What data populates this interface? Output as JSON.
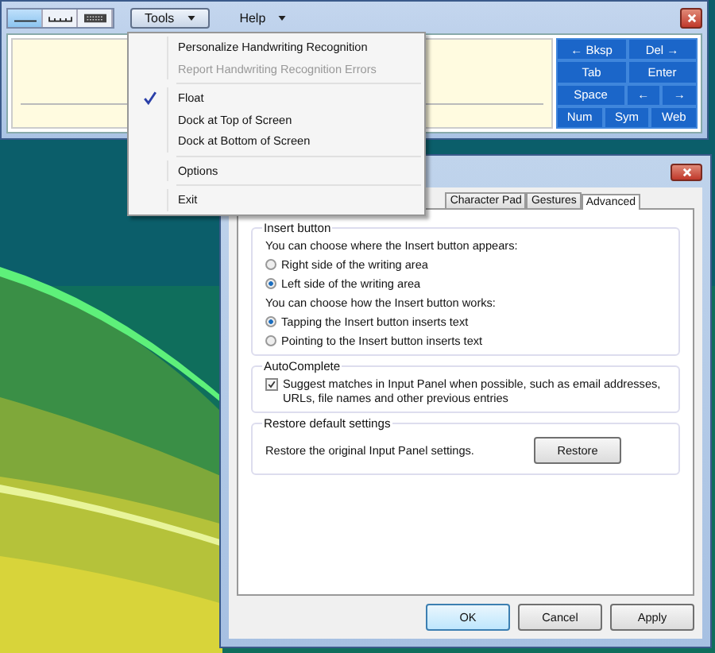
{
  "input_panel": {
    "mode_buttons": [
      {
        "selected": true
      },
      {
        "selected": false
      },
      {
        "selected": false
      }
    ],
    "menus": [
      {
        "label": "Tools",
        "open": true
      },
      {
        "label": "Help",
        "open": false
      }
    ],
    "keys": [
      [
        {
          "label": "← Bksp",
          "kind": "normal"
        },
        {
          "label": "Del →",
          "kind": "normal"
        }
      ],
      [
        {
          "label": "Tab",
          "kind": "normal"
        },
        {
          "label": "Enter",
          "kind": "normal"
        }
      ],
      [
        {
          "label": "Space",
          "kind": "wide"
        },
        {
          "label": "←",
          "kind": "normal"
        },
        {
          "label": "→",
          "kind": "normal"
        }
      ],
      [
        {
          "label": "Num",
          "kind": "normal"
        },
        {
          "label": "Sym",
          "kind": "normal"
        },
        {
          "label": "Web",
          "kind": "normal"
        }
      ]
    ]
  },
  "tools_menu": [
    [
      {
        "label": "Personalize Handwriting Recognition",
        "disabled": false,
        "checked": false
      },
      {
        "label": "Report Handwriting Recognition Errors",
        "disabled": true,
        "checked": false
      }
    ],
    [
      {
        "label": "Float",
        "disabled": false,
        "checked": true
      },
      {
        "label": "Dock at Top of Screen",
        "disabled": false,
        "checked": false
      },
      {
        "label": "Dock at Bottom of Screen",
        "disabled": false,
        "checked": false
      }
    ],
    [
      {
        "label": "Options",
        "disabled": false,
        "checked": false
      }
    ],
    [
      {
        "label": "Exit",
        "disabled": false,
        "checked": false
      }
    ]
  ],
  "dialog": {
    "tabs": [
      {
        "label": "Character Pad",
        "selected": false
      },
      {
        "label": "Gestures",
        "selected": false
      },
      {
        "label": "Advanced",
        "selected": true
      }
    ],
    "insert_button": {
      "title": "Insert button",
      "prompt_position": "You can choose where the Insert button appears:",
      "position_options": [
        {
          "label": "Right side of the writing area",
          "selected": false
        },
        {
          "label": "Left side of the writing area",
          "selected": true
        }
      ],
      "prompt_behavior": "You can choose how the Insert button works:",
      "behavior_options": [
        {
          "label": "Tapping the Insert button inserts text",
          "selected": true
        },
        {
          "label": "Pointing to the Insert button inserts text",
          "selected": false
        }
      ]
    },
    "autocomplete": {
      "title": "AutoComplete",
      "label": "Suggest matches in Input Panel when possible, such as email addresses, URLs, file names and other previous entries",
      "checked": true
    },
    "restore": {
      "title": "Restore default settings",
      "text": "Restore the original Input Panel settings.",
      "button": "Restore"
    },
    "buttons": [
      {
        "label": "OK",
        "kind": "default"
      },
      {
        "label": "Cancel",
        "kind": "normal"
      },
      {
        "label": "Apply",
        "kind": "normal"
      }
    ]
  }
}
